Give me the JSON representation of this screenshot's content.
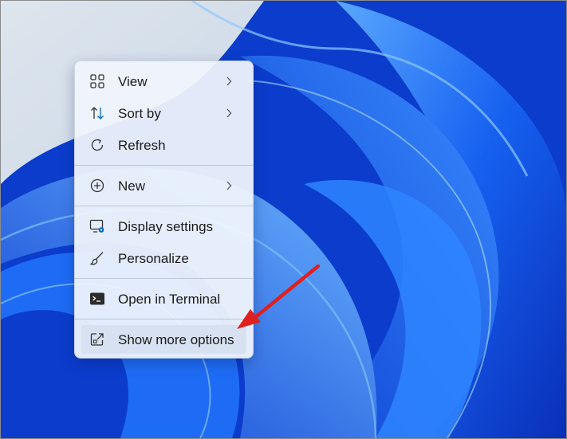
{
  "context_menu": {
    "items": [
      {
        "label": "View",
        "icon": "grid-view-icon",
        "has_submenu": true
      },
      {
        "label": "Sort by",
        "icon": "sort-icon",
        "has_submenu": true
      },
      {
        "label": "Refresh",
        "icon": "refresh-icon",
        "has_submenu": false
      },
      {
        "label": "New",
        "icon": "plus-circle-icon",
        "has_submenu": true
      },
      {
        "label": "Display settings",
        "icon": "display-settings-icon",
        "has_submenu": false
      },
      {
        "label": "Personalize",
        "icon": "brush-icon",
        "has_submenu": false
      },
      {
        "label": "Open in Terminal",
        "icon": "terminal-icon",
        "has_submenu": false
      },
      {
        "label": "Show more options",
        "icon": "open-external-icon",
        "has_submenu": false,
        "highlighted": true
      }
    ]
  },
  "annotation": {
    "arrow_color": "#e0201e"
  },
  "colors": {
    "accent": "#0067c0",
    "wallpaper_blue": "#0a4fe0"
  }
}
